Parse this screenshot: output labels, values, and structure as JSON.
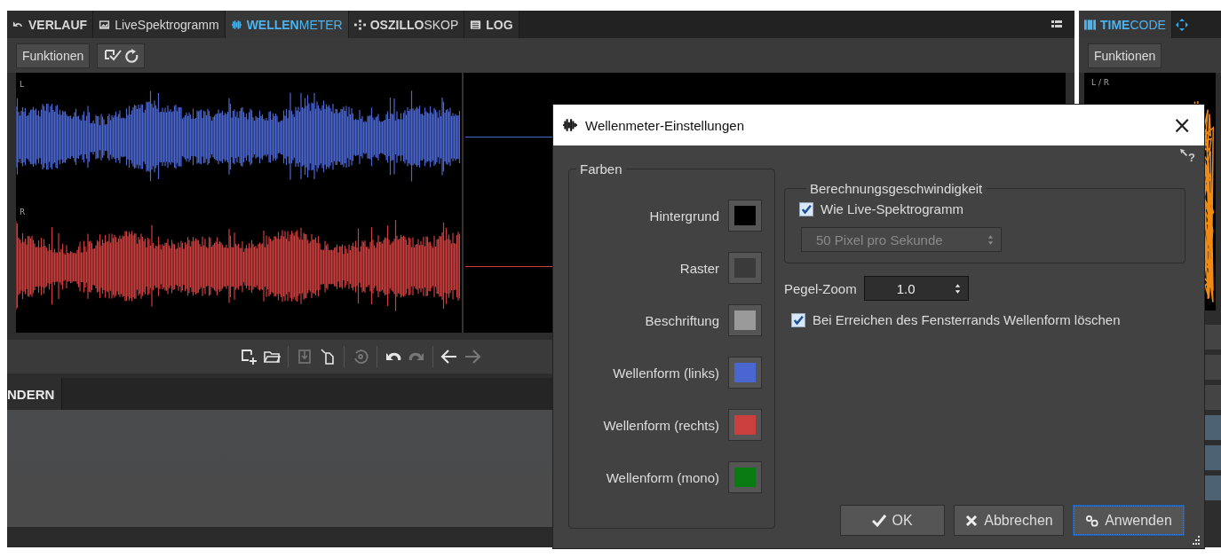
{
  "tabs": [
    {
      "label": "VERLAUF",
      "bold": true,
      "selected": false
    },
    {
      "label": "LiveSpektrogramm",
      "bold": false,
      "selected": false
    },
    {
      "label": "**WELLEN**METER",
      "bold": false,
      "selected": true
    },
    {
      "label": "**OSZILLO**SKOP",
      "bold": false,
      "selected": false
    },
    {
      "label": "LOG",
      "bold": true,
      "selected": false
    }
  ],
  "functions_button": "Funktionen",
  "display": {
    "left_label": "L",
    "right_label": "R"
  },
  "toolbar_icons": [
    {
      "disabled": false
    },
    {
      "disabled": false
    },
    {
      "disabled": true
    },
    {
      "disabled": false
    },
    {
      "disabled": true
    },
    {
      "disabled": false
    },
    {
      "disabled": true
    },
    {
      "disabled": false
    },
    {
      "disabled": true
    }
  ],
  "lower_tab": "NDERN",
  "right_panel": {
    "tab": "**TIME**CODE",
    "functions_button": "Funktionen",
    "display_label": "L / R"
  },
  "dialog": {
    "title": "Wellenmeter-Einstellungen",
    "close": "×",
    "help": "?",
    "colors_group": "Farben",
    "colors": [
      {
        "label": "Hintergrund",
        "color": "#000000"
      },
      {
        "label": "Raster",
        "color": "#3a3a3a"
      },
      {
        "label": "Beschriftung",
        "color": "#9a9a9a"
      },
      {
        "label": "Wellenform (links)",
        "color": "#4a66d0"
      },
      {
        "label": "Wellenform (rechts)",
        "color": "#cc3f3f"
      },
      {
        "label": "Wellenform (mono)",
        "color": "#0a7a12"
      }
    ],
    "speed_group": "Berechnungsgeschwindigkeit",
    "like_live": {
      "label": "Wie Live-Spektrogramm",
      "checked": true
    },
    "speed_value": {
      "value": "50 Pixel pro Sekunde",
      "disabled": true
    },
    "zoom_label": "Pegel-Zoom",
    "zoom_value": "1.0",
    "clear_at_edge": {
      "label": "Bei Erreichen des Fensterrands Wellenform löschen",
      "checked": true
    },
    "buttons": [
      {
        "label": "OK",
        "kind": "ok",
        "focused": false
      },
      {
        "label": "Abbrechen",
        "kind": "cancel",
        "focused": false
      },
      {
        "label": "Anwenden",
        "kind": "apply",
        "focused": true
      }
    ]
  }
}
